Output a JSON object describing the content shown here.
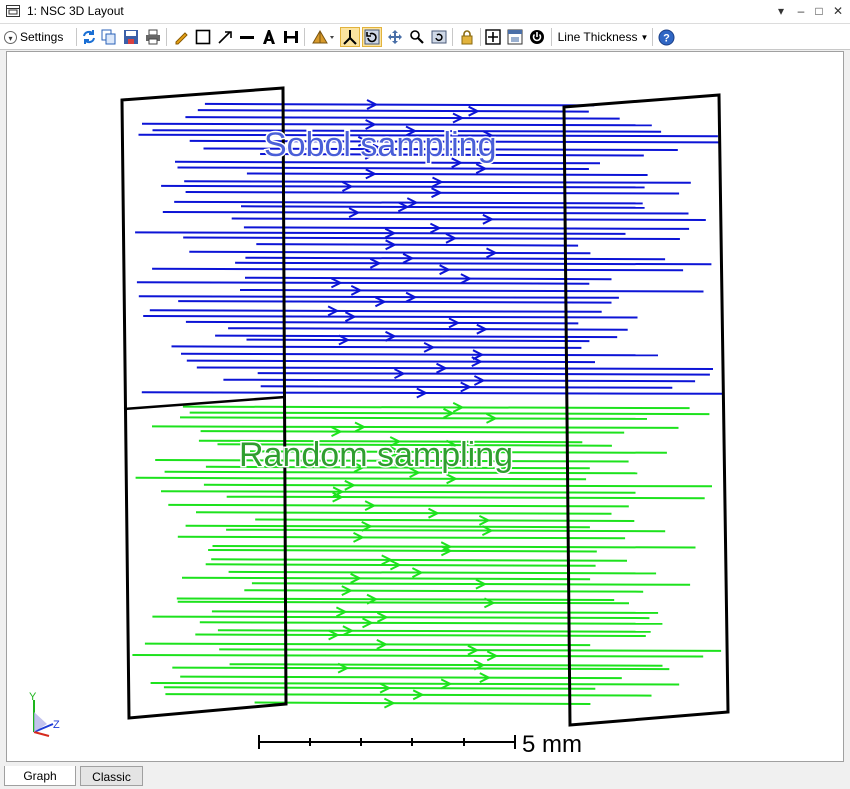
{
  "window": {
    "title": "1: NSC 3D Layout",
    "controls": [
      "▾",
      "–",
      "□",
      "✕"
    ]
  },
  "toolbar": {
    "settings_label": "Settings",
    "line_thickness_label": "Line Thickness",
    "icons": [
      "refresh-icon",
      "copy-icon",
      "save-icon",
      "print-icon",
      "pencil-icon",
      "rectangle-icon",
      "arrow-icon",
      "line-icon",
      "text-icon",
      "dimension-icon",
      "camera-icon",
      "axes-icon",
      "rotate-icon",
      "pan-icon",
      "zoom-icon",
      "reset-icon",
      "lock-icon",
      "fit-icon",
      "window-icon",
      "power-icon",
      "help-icon"
    ]
  },
  "plot": {
    "labels": {
      "sobol": "Sobol sampling",
      "random": "Random sampling"
    },
    "scale_bar": {
      "label": "5 mm"
    },
    "axes": {
      "y": "Y",
      "z": "Z"
    },
    "colors": {
      "sobol": "#0c14d6",
      "random": "#1de21d",
      "frame": "#000000"
    }
  },
  "tabs": [
    {
      "label": "Graph",
      "active": true
    },
    {
      "label": "Classic",
      "active": false
    }
  ]
}
